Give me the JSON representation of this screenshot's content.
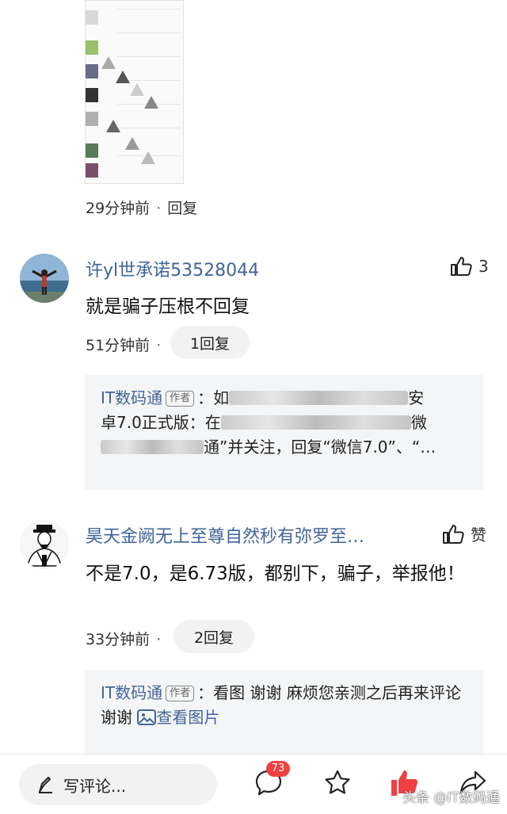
{
  "top_comment": {
    "time": "29分钟前",
    "reply_label": "回复"
  },
  "comments": [
    {
      "username": "许yl世承诺53528044",
      "like_count": "3",
      "text": "就是骗子压根不回复",
      "time": "51分钟前",
      "reply_count_label": "1回复",
      "reply": {
        "author": "IT数码通",
        "badge": "作者",
        "text_segments": [
          "：如",
          "安",
          "卓7.0正式版：在",
          "微",
          "通”并关注，回复“微信7.0”、“…"
        ]
      }
    },
    {
      "username": "昊天金阙无上至尊自然秒有弥罗至…",
      "like_label": "赞",
      "text": "不是7.0，是6.73版，都别下，骗子，举报他！",
      "time": "33分钟前",
      "reply_count_label": "2回复",
      "reply": {
        "author": "IT数码通",
        "badge": "作者",
        "text": "：看图 谢谢 麻烦您亲测之后再来评论 谢谢",
        "link": "查看图片"
      }
    }
  ],
  "bottom_bar": {
    "comment_placeholder": "写评论...",
    "comment_count": "73",
    "icons": [
      "pencil-icon",
      "comment-icon",
      "star-icon",
      "like-icon",
      "share-icon"
    ],
    "like_color": "#f04142"
  },
  "watermark": "头条 @IT数码通",
  "colors": {
    "username": "#406599",
    "reply_bg": "#f4f5f6",
    "accent_red": "#f04142"
  }
}
